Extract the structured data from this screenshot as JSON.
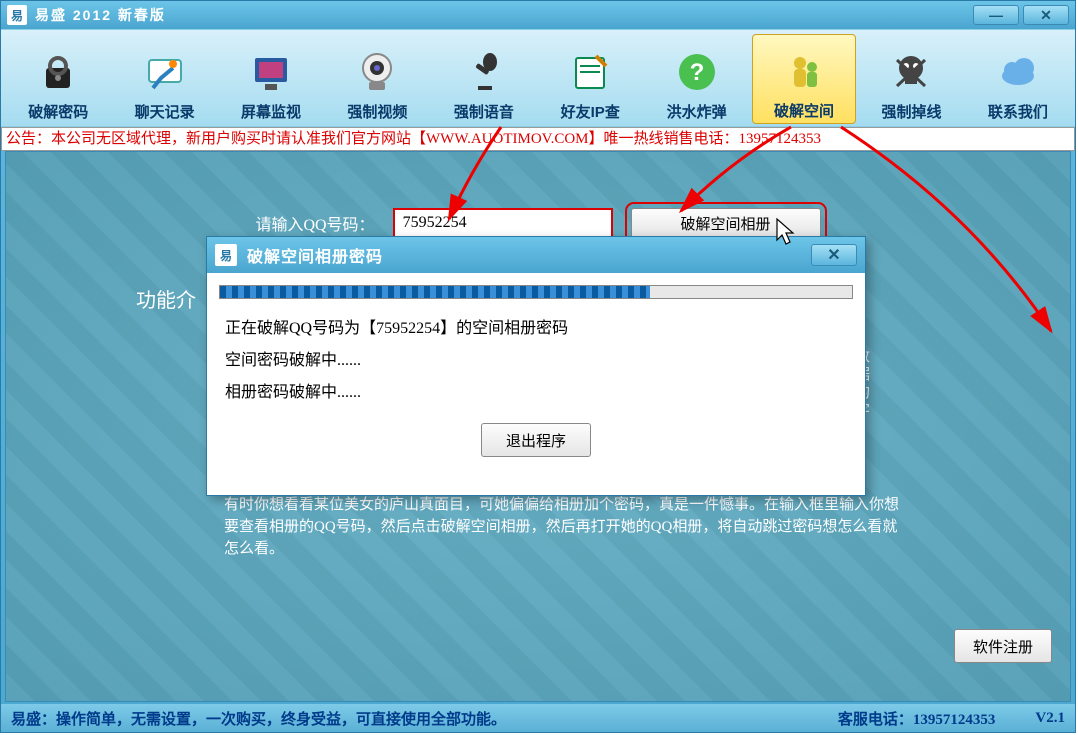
{
  "titlebar": {
    "app_glyph": "易",
    "title": "易盛  2012  新春版"
  },
  "toolbar": {
    "items": [
      {
        "label": "破解密码",
        "icon": "lock-icon"
      },
      {
        "label": "聊天记录",
        "icon": "chat-icon"
      },
      {
        "label": "屏幕监视",
        "icon": "monitor-icon"
      },
      {
        "label": "强制视频",
        "icon": "webcam-icon"
      },
      {
        "label": "强制语音",
        "icon": "mic-icon"
      },
      {
        "label": "好友IP查",
        "icon": "note-icon"
      },
      {
        "label": "洪水炸弹",
        "icon": "help-icon"
      },
      {
        "label": "破解空间",
        "icon": "people-icon"
      },
      {
        "label": "强制掉线",
        "icon": "skull-icon"
      },
      {
        "label": "联系我们",
        "icon": "cloud-icon"
      }
    ],
    "active_index": 7
  },
  "announcement": "公告：本公司无区域代理，新用户购买时请认准我们官方网站【WWW.AUOTIMOV.COM】唯一热线销售电话：13957124353",
  "form": {
    "label": "请输入QQ号码：",
    "value": "75952254",
    "button": "破解空间相册"
  },
  "func_label": "功能介",
  "side_text": "数据的字",
  "desc": "有时你想看看某位美女的庐山真面目，可她偏偏给相册加个密码，真是一件憾事。在输入框里输入你想要查看相册的QQ号码，然后点击破解空间相册，然后再打开她的QQ相册，将自动跳过密码想怎么看就怎么看。",
  "register_btn": "软件注册",
  "status": {
    "left": "易盛：操作简单，无需设置，一次购买，终身受益，可直接使用全部功能。",
    "phone_label": "客服电话：",
    "phone": "13957124353",
    "version": "V2.1"
  },
  "dialog": {
    "app_glyph": "易",
    "title": "破解空间相册密码",
    "line1": "正在破解QQ号码为【75952254】的空间相册密码",
    "line2": "空间密码破解中......",
    "line3": "相册密码破解中......",
    "exit_btn": "退出程序",
    "progress_percent": 68
  }
}
